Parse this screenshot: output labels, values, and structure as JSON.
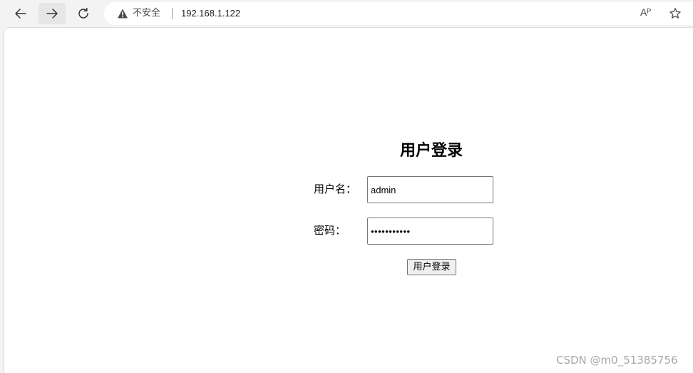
{
  "browser": {
    "insecure_label": "不安全",
    "url": "192.168.1.122",
    "read_aloud_glyph": "Aᴾ",
    "icons": {
      "back": "arrow-left-icon",
      "forward": "arrow-right-icon",
      "reload": "reload-icon",
      "warning": "warning-triangle-icon",
      "read_aloud": "read-aloud-icon",
      "favorite": "star-outline-icon"
    }
  },
  "login_form": {
    "title": "用户登录",
    "username_label": "用户名：",
    "username_value": "admin",
    "password_label": "密码：",
    "password_value": "•••••••••••",
    "submit_label": "用户登录"
  },
  "watermark": "CSDN @m0_51385756"
}
